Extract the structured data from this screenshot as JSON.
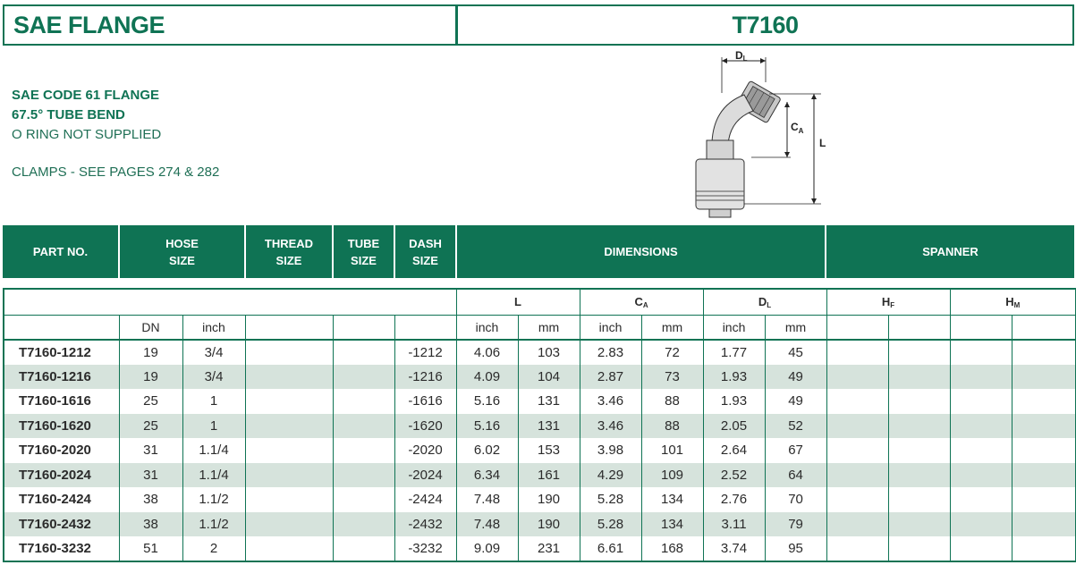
{
  "header": {
    "title_left": "SAE FLANGE",
    "title_right": "T7160"
  },
  "description": {
    "line1": "SAE CODE 61 FLANGE",
    "line2": "67.5° TUBE BEND",
    "line3": "O RING NOT SUPPLIED",
    "line4": "CLAMPS - SEE PAGES 274 & 282"
  },
  "diagram": {
    "dl_main": "D",
    "dl_sub": "L",
    "ca_main": "C",
    "ca_sub": "A",
    "l_label": "L",
    "icon": "hose-fitting-diagram-icon"
  },
  "columns": {
    "part_no": "PART NO.",
    "hose_1": "HOSE",
    "hose_2": "SIZE",
    "thread_1": "THREAD",
    "thread_2": "SIZE",
    "tube_1": "TUBE",
    "tube_2": "SIZE",
    "dash_1": "DASH",
    "dash_2": "SIZE",
    "dimensions": "DIMENSIONS",
    "spanner": "SPANNER"
  },
  "subheaders": {
    "l": "L",
    "ca_main": "C",
    "ca_sub": "A",
    "dl_main": "D",
    "dl_sub": "L",
    "hf_main": "H",
    "hf_sub": "F",
    "hm_main": "H",
    "hm_sub": "M",
    "dn": "DN",
    "inch": "inch",
    "mm": "mm"
  },
  "rows": [
    {
      "part": "T7160-1212",
      "dn": "19",
      "inch": "3/4",
      "dash": "-1212",
      "l_in": "4.06",
      "l_mm": "103",
      "ca_in": "2.83",
      "ca_mm": "72",
      "dl_in": "1.77",
      "dl_mm": "45"
    },
    {
      "part": "T7160-1216",
      "dn": "19",
      "inch": "3/4",
      "dash": "-1216",
      "l_in": "4.09",
      "l_mm": "104",
      "ca_in": "2.87",
      "ca_mm": "73",
      "dl_in": "1.93",
      "dl_mm": "49"
    },
    {
      "part": "T7160-1616",
      "dn": "25",
      "inch": "1",
      "dash": "-1616",
      "l_in": "5.16",
      "l_mm": "131",
      "ca_in": "3.46",
      "ca_mm": "88",
      "dl_in": "1.93",
      "dl_mm": "49"
    },
    {
      "part": "T7160-1620",
      "dn": "25",
      "inch": "1",
      "dash": "-1620",
      "l_in": "5.16",
      "l_mm": "131",
      "ca_in": "3.46",
      "ca_mm": "88",
      "dl_in": "2.05",
      "dl_mm": "52"
    },
    {
      "part": "T7160-2020",
      "dn": "31",
      "inch": "1.1/4",
      "dash": "-2020",
      "l_in": "6.02",
      "l_mm": "153",
      "ca_in": "3.98",
      "ca_mm": "101",
      "dl_in": "2.64",
      "dl_mm": "67"
    },
    {
      "part": "T7160-2024",
      "dn": "31",
      "inch": "1.1/4",
      "dash": "-2024",
      "l_in": "6.34",
      "l_mm": "161",
      "ca_in": "4.29",
      "ca_mm": "109",
      "dl_in": "2.52",
      "dl_mm": "64"
    },
    {
      "part": "T7160-2424",
      "dn": "38",
      "inch": "1.1/2",
      "dash": "-2424",
      "l_in": "7.48",
      "l_mm": "190",
      "ca_in": "5.28",
      "ca_mm": "134",
      "dl_in": "2.76",
      "dl_mm": "70"
    },
    {
      "part": "T7160-2432",
      "dn": "38",
      "inch": "1.1/2",
      "dash": "-2432",
      "l_in": "7.48",
      "l_mm": "190",
      "ca_in": "5.28",
      "ca_mm": "134",
      "dl_in": "3.11",
      "dl_mm": "79"
    },
    {
      "part": "T7160-3232",
      "dn": "51",
      "inch": "2",
      "dash": "-3232",
      "l_in": "9.09",
      "l_mm": "231",
      "ca_in": "6.61",
      "ca_mm": "168",
      "dl_in": "3.74",
      "dl_mm": "95"
    }
  ],
  "colors": {
    "brand_green": "#0f7354",
    "row_alt": "#d6e3dc"
  }
}
